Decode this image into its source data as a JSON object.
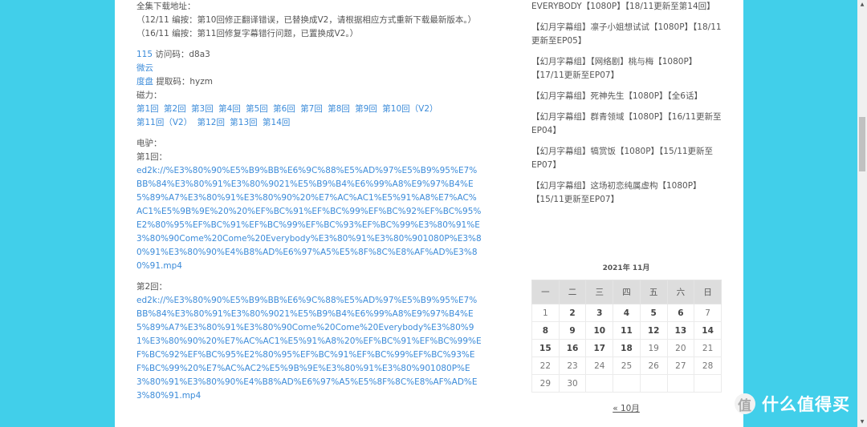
{
  "main": {
    "heading": "全集下载地址：",
    "notes": [
      "（12/11 编按：第10回修正翻译错误，已替换成V2，请根据相应方式重新下载最新版本。）",
      "（16/11 编按：第11回修复字幕错行问题，已置换成V2。）"
    ],
    "pan115": {
      "link": "115",
      "text": " 访问码：d8a3"
    },
    "weiyun": {
      "link": "微云"
    },
    "baidu": {
      "link": "度盘",
      "text": " 提取码：hyzm"
    },
    "magnet": {
      "label": "磁力：",
      "links": [
        "第1回",
        "第2回",
        "第3回",
        "第4回",
        "第5回",
        "第6回",
        "第7回",
        "第8回",
        "第9回",
        "第10回（V2）",
        "第11回（V2）",
        "第12回",
        "第13回",
        "第14回"
      ]
    },
    "edonkey": {
      "label": "电驴：",
      "episodes": [
        {
          "label": "第1回：",
          "link": "ed2k://%E3%80%90%E5%B9%BB%E6%9C%88%E5%AD%97%E5%B9%95%E7%BB%84%E3%80%91%E3%80%9021%E5%B9%B4%E6%99%A8%E9%97%B4%E5%89%A7%E3%80%91%E3%80%90%20%E7%AC%AC1%E5%91%A8%E7%AC%AC1%E5%9B%9E%20%20%EF%BC%91%EF%BC%99%EF%BC%92%EF%BC%95%E2%80%95%EF%BC%91%EF%BC%99%EF%BC%93%EF%BC%99%E3%80%91%E3%80%90Come%20Come%20Everybody%E3%80%91%E3%80%901080P%E3%80%91%E3%80%90%E4%B8%AD%E6%97%A5%E5%8F%8C%E8%AF%AD%E3%80%91.mp4"
        },
        {
          "label": "第2回：",
          "link": "ed2k://%E3%80%90%E5%B9%BB%E6%9C%88%E5%AD%97%E5%B9%95%E7%BB%84%E3%80%91%E3%80%9021%E5%B9%B4%E6%99%A8%E9%97%B4%E5%89%A7%E3%80%91%E3%80%90Come%20Come%20Everybody%E3%80%91%E3%80%90%20%E7%AC%AC1%E5%91%A8%20%EF%BC%91%EF%BC%99%EF%BC%92%EF%BC%95%E2%80%95%EF%BC%91%EF%BC%99%EF%BC%93%EF%BC%99%20%E7%AC%AC2%E5%9B%9E%E3%80%91%E3%80%901080P%E3%80%91%E3%80%90%E4%B8%AD%E6%97%A5%E5%8F%8C%E8%AF%AD%E3%80%91.mp4"
        }
      ]
    }
  },
  "sidebar": {
    "posts": [
      "EVERYBODY【1080P】【18/11更新至第14回】",
      "【幻月字幕组】凛子小姐想试试【1080P】【18/11更新至EP05】",
      "【幻月字幕组】【网络剧】桃与梅【1080P】【17/11更新至EP07】",
      "【幻月字幕组】死神先生【1080P】【全6话】",
      "【幻月字幕组】群青领域【1080P】【16/11更新至EP04】",
      "【幻月字幕组】犒赏饭【1080P】【15/11更新至EP07】",
      "【幻月字幕组】这场初恋纯属虚构【1080P】【15/11更新至EP07】"
    ],
    "calendar": {
      "title": "2021年 11月",
      "weekdays": [
        "一",
        "二",
        "三",
        "四",
        "五",
        "六",
        "日"
      ],
      "weeks": [
        [
          {
            "d": "1",
            "p": false
          },
          {
            "d": "2",
            "p": true
          },
          {
            "d": "3",
            "p": true
          },
          {
            "d": "4",
            "p": true
          },
          {
            "d": "5",
            "p": true
          },
          {
            "d": "6",
            "p": true
          },
          {
            "d": "7",
            "p": false
          }
        ],
        [
          {
            "d": "8",
            "p": true
          },
          {
            "d": "9",
            "p": true
          },
          {
            "d": "10",
            "p": true
          },
          {
            "d": "11",
            "p": true
          },
          {
            "d": "12",
            "p": true
          },
          {
            "d": "13",
            "p": true
          },
          {
            "d": "14",
            "p": true
          }
        ],
        [
          {
            "d": "15",
            "p": true
          },
          {
            "d": "16",
            "p": true
          },
          {
            "d": "17",
            "p": true
          },
          {
            "d": "18",
            "p": true
          },
          {
            "d": "19",
            "p": false
          },
          {
            "d": "20",
            "p": false
          },
          {
            "d": "21",
            "p": false
          }
        ],
        [
          {
            "d": "22",
            "p": false
          },
          {
            "d": "23",
            "p": false
          },
          {
            "d": "24",
            "p": false
          },
          {
            "d": "25",
            "p": false
          },
          {
            "d": "26",
            "p": false
          },
          {
            "d": "27",
            "p": false
          },
          {
            "d": "28",
            "p": false
          }
        ],
        [
          {
            "d": "29",
            "p": false
          },
          {
            "d": "30",
            "p": false
          },
          {
            "d": "",
            "p": false
          },
          {
            "d": "",
            "p": false
          },
          {
            "d": "",
            "p": false
          },
          {
            "d": "",
            "p": false
          },
          {
            "d": "",
            "p": false
          }
        ]
      ],
      "prev_link": "« 10月"
    }
  },
  "watermark": {
    "badge": "值",
    "text": "什么值得买"
  },
  "scrollbar": {
    "up": "▲",
    "down": "▼"
  },
  "colors": {
    "background": "#41cfea",
    "link": "#3b8bd9"
  }
}
